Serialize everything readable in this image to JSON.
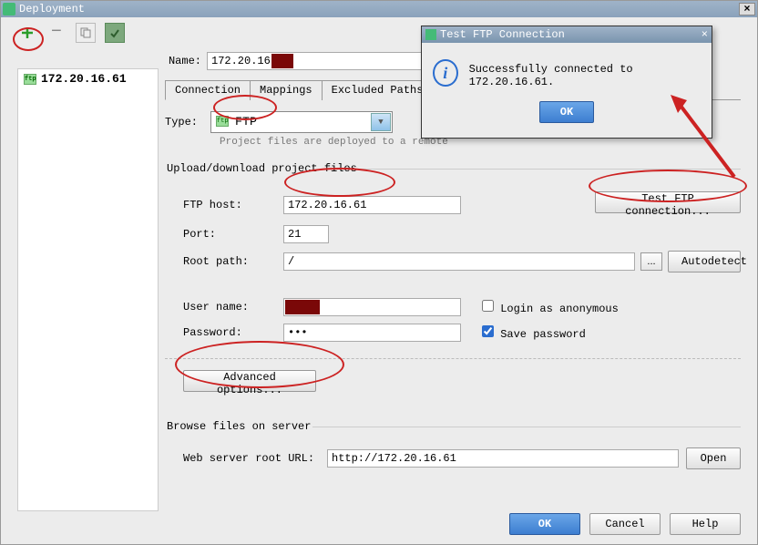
{
  "window": {
    "title": "Deployment"
  },
  "sidebar": {
    "items": [
      {
        "label": "172.20.16.61"
      }
    ]
  },
  "name": {
    "label": "Name:",
    "value": "172.20.16."
  },
  "tabs": {
    "connection": "Connection",
    "mappings": "Mappings",
    "excluded": "Excluded Paths"
  },
  "type": {
    "label": "Type:",
    "value": "FTP",
    "note": "Project files are deployed to a remote"
  },
  "upload": {
    "legend": "Upload/download project files",
    "host_label": "FTP host:",
    "host_value": "172.20.16.61",
    "test_btn": "Test FTP connection...",
    "port_label": "Port:",
    "port_value": "21",
    "root_label": "Root path:",
    "root_value": "/",
    "autodetect": "Autodetect",
    "user_label": "User name:",
    "user_value": "",
    "login_anon": "Login as anonymous",
    "pass_label": "Password:",
    "pass_value": "•••",
    "save_pass": "Save password",
    "advanced": "Advanced options..."
  },
  "browse": {
    "legend": "Browse files on server",
    "url_label": "Web server root URL:",
    "url_value": "http://172.20.16.61",
    "open": "Open"
  },
  "footer": {
    "ok": "OK",
    "cancel": "Cancel",
    "help": "Help"
  },
  "popup": {
    "title": "Test FTP Connection",
    "message": "Successfully connected to 172.20.16.61.",
    "ok": "OK"
  }
}
